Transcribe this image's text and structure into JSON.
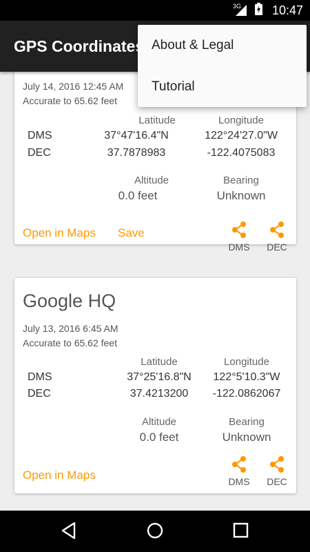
{
  "status_bar": {
    "network": "3G",
    "time": "10:47"
  },
  "app_bar": {
    "title": "GPS Coordinates"
  },
  "menu": {
    "items": [
      "About & Legal",
      "Tutorial"
    ]
  },
  "labels": {
    "latitude": "Latitude",
    "longitude": "Longitude",
    "altitude": "Altitude",
    "bearing": "Bearing",
    "dms": "DMS",
    "dec": "DEC",
    "open_in_maps": "Open in Maps",
    "save": "Save"
  },
  "cards": [
    {
      "date": "July 14, 2016 12:45 AM",
      "accuracy": "Accurate to 65.62 feet",
      "lat_dms": "37°47'16.4\"N",
      "lon_dms": "122°24'27.0\"W",
      "lat_dec": "37.7878983",
      "lon_dec": "-122.4075083",
      "altitude": "0.0 feet",
      "bearing": "Unknown"
    },
    {
      "name": "Google HQ",
      "date": "July 13, 2016 6:45 AM",
      "accuracy": "Accurate to 65.62 feet",
      "lat_dms": "37°25'16.8\"N",
      "lon_dms": "122°5'10.3\"W",
      "lat_dec": "37.4213200",
      "lon_dec": "-122.0862067",
      "altitude": "0.0 feet",
      "bearing": "Unknown"
    }
  ],
  "colors": {
    "accent": "#ff9800",
    "app_bar": "#212121"
  },
  "icons": {
    "share": "share-icon",
    "back": "back-triangle-icon",
    "home": "home-circle-icon",
    "recents": "recents-square-icon"
  }
}
